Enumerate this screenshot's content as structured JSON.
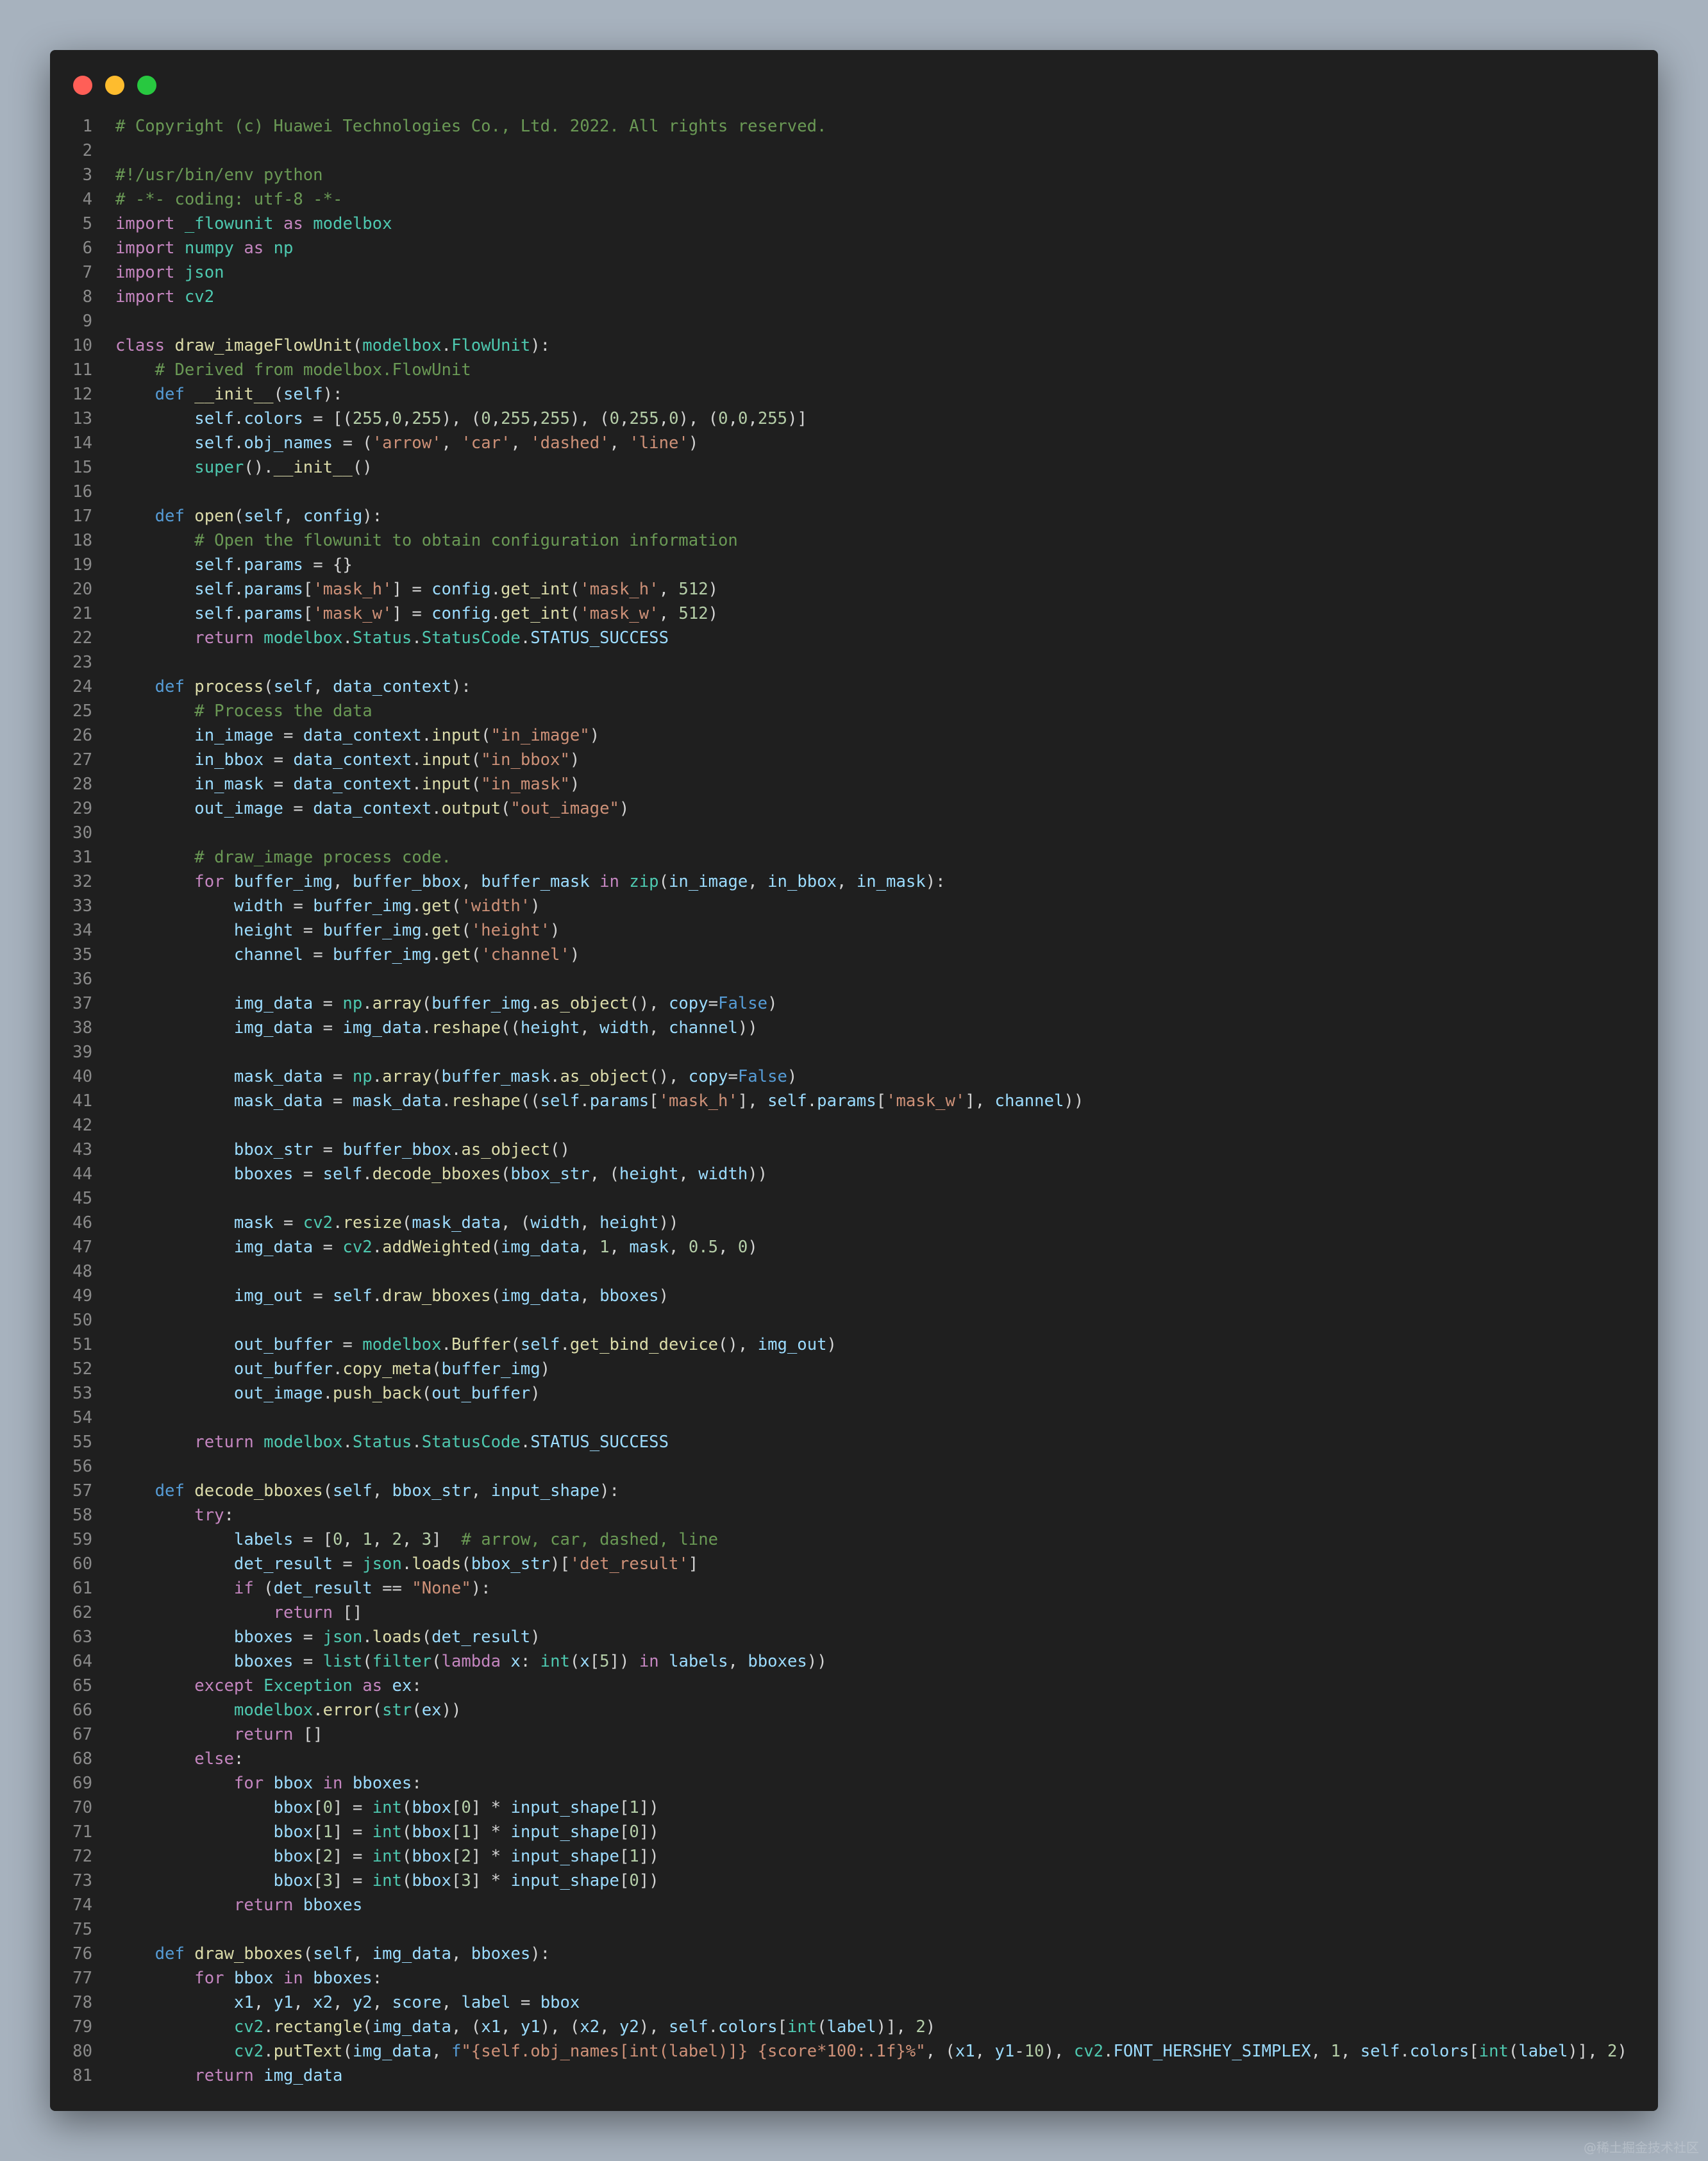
{
  "editor": {
    "language": "python",
    "theme_colors": {
      "background": "#1f1f1f",
      "comment": "#6a9955",
      "keyword": "#c586c0",
      "storage": "#569cd6",
      "type": "#4ec9b0",
      "function": "#dcdcaa",
      "variable": "#9cdcfe",
      "string": "#ce9178",
      "number": "#b5cea8",
      "plain": "#d4d4d4",
      "line_number": "#8a8a8a"
    },
    "window_buttons": [
      {
        "name": "close",
        "color": "#ff5f57"
      },
      {
        "name": "minimize",
        "color": "#febc2e"
      },
      {
        "name": "maximize",
        "color": "#28c840"
      }
    ],
    "lines": [
      "# Copyright (c) Huawei Technologies Co., Ltd. 2022. All rights reserved.",
      "",
      "#!/usr/bin/env python",
      "# -*- coding: utf-8 -*-",
      "import _flowunit as modelbox",
      "import numpy as np",
      "import json",
      "import cv2",
      "",
      "class draw_imageFlowUnit(modelbox.FlowUnit):",
      "    # Derived from modelbox.FlowUnit",
      "    def __init__(self):",
      "        self.colors = [(255,0,255), (0,255,255), (0,255,0), (0,0,255)]",
      "        self.obj_names = ('arrow', 'car', 'dashed', 'line')",
      "        super().__init__()",
      "",
      "    def open(self, config):",
      "        # Open the flowunit to obtain configuration information",
      "        self.params = {}",
      "        self.params['mask_h'] = config.get_int('mask_h', 512)",
      "        self.params['mask_w'] = config.get_int('mask_w', 512)",
      "        return modelbox.Status.StatusCode.STATUS_SUCCESS",
      "",
      "    def process(self, data_context):",
      "        # Process the data",
      "        in_image = data_context.input(\"in_image\")",
      "        in_bbox = data_context.input(\"in_bbox\")",
      "        in_mask = data_context.input(\"in_mask\")",
      "        out_image = data_context.output(\"out_image\")",
      "",
      "        # draw_image process code.",
      "        for buffer_img, buffer_bbox, buffer_mask in zip(in_image, in_bbox, in_mask):",
      "            width = buffer_img.get('width')",
      "            height = buffer_img.get('height')",
      "            channel = buffer_img.get('channel')",
      "",
      "            img_data = np.array(buffer_img.as_object(), copy=False)",
      "            img_data = img_data.reshape((height, width, channel))",
      "",
      "            mask_data = np.array(buffer_mask.as_object(), copy=False)",
      "            mask_data = mask_data.reshape((self.params['mask_h'], self.params['mask_w'], channel))",
      "",
      "            bbox_str = buffer_bbox.as_object()",
      "            bboxes = self.decode_bboxes(bbox_str, (height, width))",
      "",
      "            mask = cv2.resize(mask_data, (width, height))",
      "            img_data = cv2.addWeighted(img_data, 1, mask, 0.5, 0)",
      "",
      "            img_out = self.draw_bboxes(img_data, bboxes)",
      "",
      "            out_buffer = modelbox.Buffer(self.get_bind_device(), img_out)",
      "            out_buffer.copy_meta(buffer_img)",
      "            out_image.push_back(out_buffer)",
      "",
      "        return modelbox.Status.StatusCode.STATUS_SUCCESS",
      "",
      "    def decode_bboxes(self, bbox_str, input_shape):",
      "        try:",
      "            labels = [0, 1, 2, 3]  # arrow, car, dashed, line",
      "            det_result = json.loads(bbox_str)['det_result']",
      "            if (det_result == \"None\"):",
      "                return []",
      "            bboxes = json.loads(det_result)",
      "            bboxes = list(filter(lambda x: int(x[5]) in labels, bboxes))",
      "        except Exception as ex:",
      "            modelbox.error(str(ex))",
      "            return []",
      "        else:",
      "            for bbox in bboxes:",
      "                bbox[0] = int(bbox[0] * input_shape[1])",
      "                bbox[1] = int(bbox[1] * input_shape[0])",
      "                bbox[2] = int(bbox[2] * input_shape[1])",
      "                bbox[3] = int(bbox[3] * input_shape[0])",
      "            return bboxes",
      "",
      "    def draw_bboxes(self, img_data, bboxes):",
      "        for bbox in bboxes:",
      "            x1, y1, x2, y2, score, label = bbox",
      "            cv2.rectangle(img_data, (x1, y1), (x2, y2), self.colors[int(label)], 2)",
      "            cv2.putText(img_data, f\"{self.obj_names[int(label)]} {score*100:.1f}%\", (x1, y1-10), cv2.FONT_HERSHEY_SIMPLEX, 1, self.colors[int(label)], 2)",
      "        return img_data"
    ]
  },
  "watermark": "@稀土掘金技术社区"
}
